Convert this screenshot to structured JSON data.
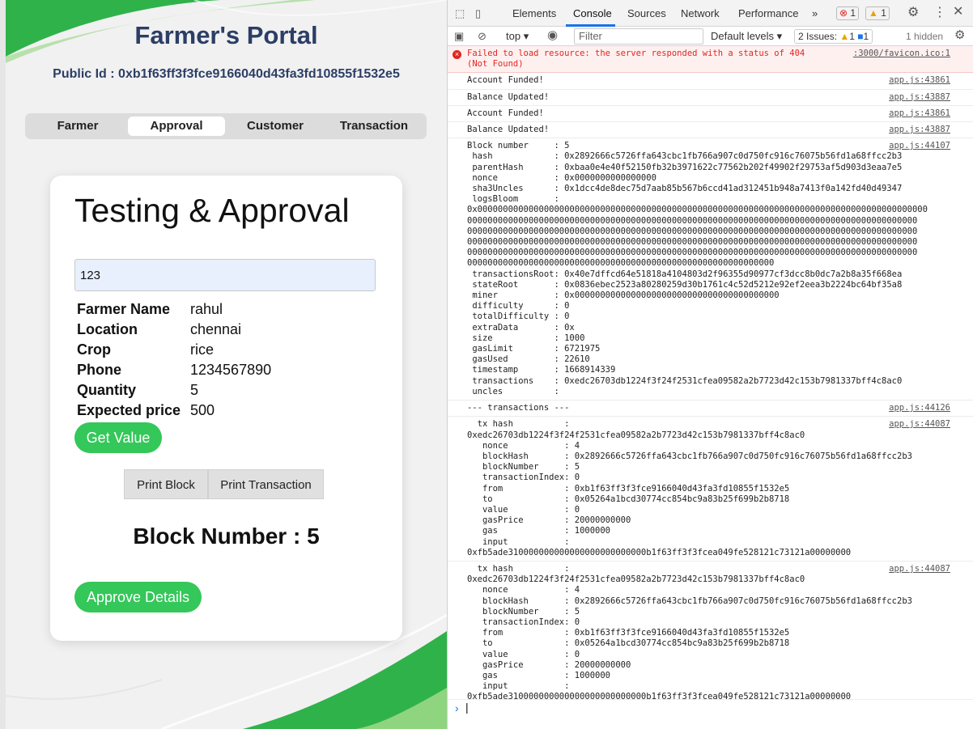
{
  "app": {
    "title": "Farmer's Portal",
    "public_id": "Public Id : 0xb1f63ff3f3fce9166040d43fa3fd10855f1532e5",
    "tabs": [
      "Farmer",
      "Approval",
      "Customer",
      "Transaction"
    ],
    "active_tab": "Approval",
    "card": {
      "heading": "Testing & Approval",
      "input_value": "123",
      "fields": [
        {
          "label": "Farmer Name",
          "value": "rahul"
        },
        {
          "label": "Location",
          "value": "chennai"
        },
        {
          "label": "Crop",
          "value": "rice"
        },
        {
          "label": "Phone",
          "value": "1234567890"
        },
        {
          "label": "Quantity",
          "value": "5"
        },
        {
          "label": "Expected price",
          "value": "500"
        }
      ],
      "get_value_label": "Get Value",
      "print_block_label": "Print Block",
      "print_transaction_label": "Print Transaction",
      "block_number_text": "Block Number : 5",
      "approve_label": "Approve Details"
    },
    "colors": {
      "accent_green": "#34c759",
      "title_navy": "#2c3e66",
      "leaf_green": "#2fb24a"
    }
  },
  "devtools": {
    "tabs": [
      "Elements",
      "Console",
      "Sources",
      "Network",
      "Performance"
    ],
    "active_tab": "Console",
    "more_tabs": "»",
    "error_count": "1",
    "warning_count": "1",
    "context": "top",
    "filter_placeholder": "Filter",
    "levels": "Default levels",
    "issues_label": "2 Issues:",
    "issues_warn": "1",
    "issues_info": "1",
    "hidden": "1 hidden",
    "console": [
      {
        "type": "error",
        "text": "Failed to load resource: the server responded with a status of 404\n(Not Found)",
        "source": ":3000/favicon.ico:1"
      },
      {
        "type": "log",
        "text": "Account Funded!",
        "source": "app.js:43861"
      },
      {
        "type": "log",
        "text": "Balance Updated!",
        "source": "app.js:43887"
      },
      {
        "type": "log",
        "text": "Account Funded!",
        "source": "app.js:43861"
      },
      {
        "type": "log",
        "text": "Balance Updated!",
        "source": "app.js:43887"
      },
      {
        "type": "log",
        "text": "Block number     : 5\n hash            : 0x2892666c5726ffa643cbc1fb766a907c0d750fc916c76075b56fd1a68ffcc2b3\n parentHash      : 0xbaa0e4e40f52150fb32b3971622c77562b202f49902f29753af5d903d3eaa7e5\n nonce           : 0x0000000000000000\n sha3Uncles      : 0x1dcc4de8dec75d7aab85b567b6ccd41ad312451b948a7413f0a142fd40d49347\n logsBloom       :\n0x0000000000000000000000000000000000000000000000000000000000000000000000000000000000000000\n0000000000000000000000000000000000000000000000000000000000000000000000000000000000000000\n0000000000000000000000000000000000000000000000000000000000000000000000000000000000000000\n0000000000000000000000000000000000000000000000000000000000000000000000000000000000000000\n0000000000000000000000000000000000000000000000000000000000000000000000000000000000000000\n000000000000000000000000000000000000000000000000000000000000\n transactionsRoot: 0x40e7dffcd64e51818a4104803d2f96355d90977cf3dcc8b0dc7a2b8a35f668ea\n stateRoot       : 0x0836ebec2523a80280259d30b1761c4c52d5212e92ef2eea3b2224bc64bf35a8\n miner           : 0x0000000000000000000000000000000000000000\n difficulty      : 0\n totalDifficulty : 0\n extraData       : 0x\n size            : 1000\n gasLimit        : 6721975\n gasUsed         : 22610\n timestamp       : 1668914339\n transactions    : 0xedc26703db1224f3f24f2531cfea09582a2b7723d42c153b7981337bff4c8ac0\n uncles          :",
        "source": "app.js:44107"
      },
      {
        "type": "log",
        "text": "--- transactions ---",
        "source": "app.js:44126"
      },
      {
        "type": "log",
        "text": "  tx hash          :\n0xedc26703db1224f3f24f2531cfea09582a2b7723d42c153b7981337bff4c8ac0\n   nonce           : 4\n   blockHash       : 0x2892666c5726ffa643cbc1fb766a907c0d750fc916c76075b56fd1a68ffcc2b3\n   blockNumber     : 5\n   transactionIndex: 0\n   from            : 0xb1f63ff3f3fce9166040d43fa3fd10855f1532e5\n   to              : 0x05264a1bcd30774cc854bc9a83b25f699b2b8718\n   value           : 0\n   gasPrice        : 20000000000\n   gas             : 1000000\n   input           :\n0xfb5ade310000000000000000000000000b1f63ff3f3fcea049fe528121c73121a00000000",
        "source": "app.js:44087"
      },
      {
        "type": "log",
        "text": "  tx hash          :\n0xedc26703db1224f3f24f2531cfea09582a2b7723d42c153b7981337bff4c8ac0\n   nonce           : 4\n   blockHash       : 0x2892666c5726ffa643cbc1fb766a907c0d750fc916c76075b56fd1a68ffcc2b3\n   blockNumber     : 5\n   transactionIndex: 0\n   from            : 0xb1f63ff3f3fce9166040d43fa3fd10855f1532e5\n   to              : 0x05264a1bcd30774cc854bc9a83b25f699b2b8718\n   value           : 0\n   gasPrice        : 20000000000\n   gas             : 1000000\n   input           :\n0xfb5ade310000000000000000000000000b1f63ff3f3fcea049fe528121c73121a00000000",
        "source": "app.js:44087"
      }
    ]
  }
}
